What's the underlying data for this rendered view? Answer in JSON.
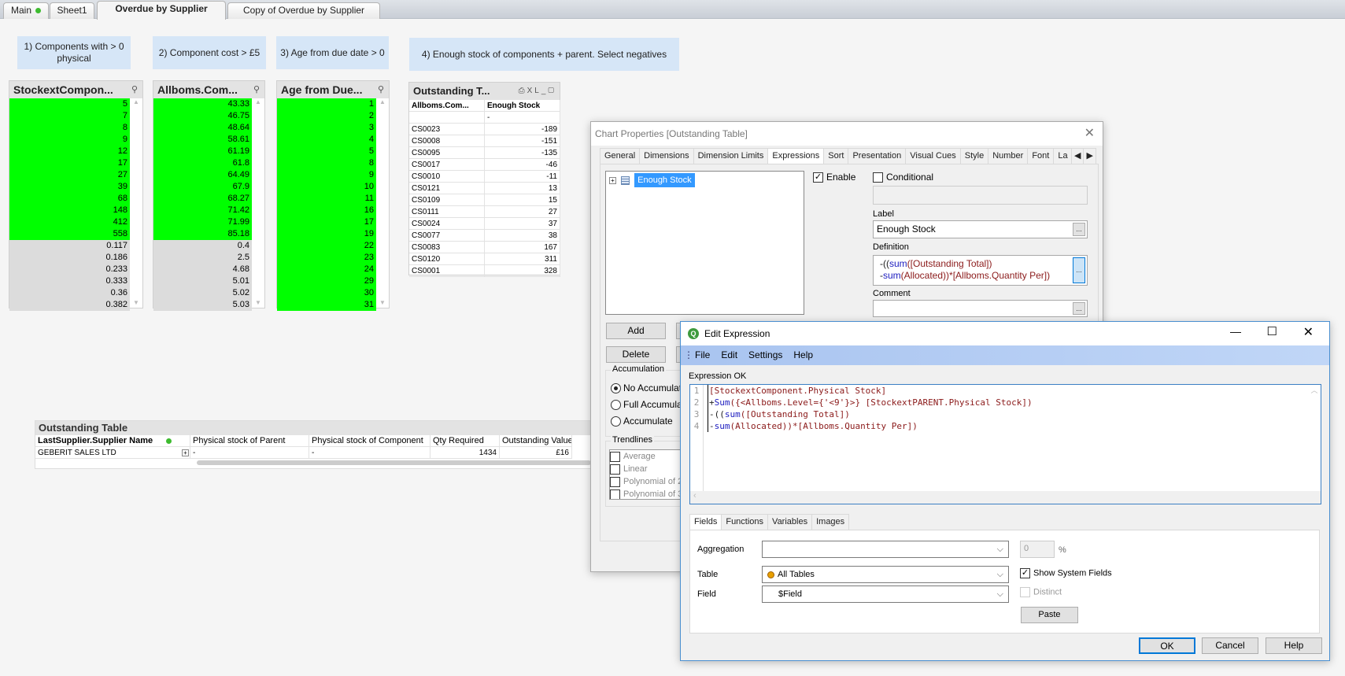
{
  "sheet_tabs": [
    {
      "label": "Main",
      "status": "green"
    },
    {
      "label": "Sheet1"
    },
    {
      "label": "Overdue by Supplier",
      "active": true
    },
    {
      "label": "Copy of Overdue by Supplier"
    }
  ],
  "text_boxes": [
    "1) Components with > 0 physical",
    "2) Component cost > £5",
    "3) Age from due date > 0",
    "4) Enough stock of components + parent. Select negatives"
  ],
  "listboxes": [
    {
      "title": "StockextCompon...",
      "selected": [
        "5",
        "7",
        "8",
        "9",
        "12",
        "17",
        "27",
        "39",
        "68",
        "148",
        "412",
        "558"
      ],
      "excluded": [
        "0.117",
        "0.186",
        "0.233",
        "0.333",
        "0.36",
        "0.382"
      ]
    },
    {
      "title": "Allboms.Com...",
      "selected": [
        "43.33",
        "46.75",
        "48.64",
        "58.61",
        "61.19",
        "61.8",
        "64.49",
        "67.9",
        "68.27",
        "71.42",
        "71.99",
        "85.18"
      ],
      "excluded": [
        "0.4",
        "2.5",
        "4.68",
        "5.01",
        "5.02",
        "5.03"
      ]
    },
    {
      "title": "Age from Due...",
      "selected": [
        "1",
        "2",
        "3",
        "4",
        "5",
        "8",
        "9",
        "10",
        "11",
        "16",
        "17",
        "19",
        "22",
        "23",
        "24",
        "29",
        "30",
        "31"
      ],
      "excluded": []
    }
  ],
  "mini_table": {
    "title": "Outstanding T...",
    "icons": [
      "print-icon",
      "xl-icon",
      "minimize-icon",
      "maximize-icon"
    ],
    "xl_label": "XL",
    "columns": [
      "Allboms.Com...",
      "Enough Stock"
    ],
    "total": [
      "",
      "-"
    ],
    "rows": [
      [
        "CS0023",
        "-189"
      ],
      [
        "CS0008",
        "-151"
      ],
      [
        "CS0095",
        "-135"
      ],
      [
        "CS0017",
        "-46"
      ],
      [
        "CS0010",
        "-11"
      ],
      [
        "CS0121",
        "13"
      ],
      [
        "CS0109",
        "15"
      ],
      [
        "CS0111",
        "27"
      ],
      [
        "CS0024",
        "37"
      ],
      [
        "CS0077",
        "38"
      ],
      [
        "CS0083",
        "167"
      ],
      [
        "CS0120",
        "311"
      ],
      [
        "CS0001",
        "328"
      ]
    ]
  },
  "outstanding_table": {
    "title": "Outstanding Table",
    "columns": [
      "LastSupplier.Supplier Name",
      "Physical stock of Parent",
      "Physical stock of Component",
      "Qty Required",
      "Outstanding Value"
    ],
    "rows": [
      [
        "GEBERIT SALES LTD",
        "-",
        "-",
        "1434",
        "£16"
      ]
    ]
  },
  "chart_properties": {
    "title": "Chart Properties [Outstanding Table]",
    "tabs": [
      "General",
      "Dimensions",
      "Dimension Limits",
      "Expressions",
      "Sort",
      "Presentation",
      "Visual Cues",
      "Style",
      "Number",
      "Font",
      "La"
    ],
    "active_tab": "Expressions",
    "expression_item": "Enough Stock",
    "enable_label": "Enable",
    "enable_checked": true,
    "conditional_label": "Conditional",
    "conditional_checked": false,
    "label_caption": "Label",
    "label_value": "Enough Stock",
    "definition_caption": "Definition",
    "definition_lines": [
      [
        {
          "t": "-((",
          "k": "op"
        },
        {
          "t": "sum",
          "k": "fn"
        },
        {
          "t": "([Outstanding Total])",
          "k": "fld"
        }
      ],
      [
        {
          "t": "-",
          "k": "op"
        },
        {
          "t": "sum",
          "k": "fn"
        },
        {
          "t": "(Allocated))*[Allboms.Quantity Per])",
          "k": "fld"
        }
      ]
    ],
    "comment_caption": "Comment",
    "ellipsis": "...",
    "add_label": "Add",
    "delete_label": "Delete",
    "accumulation": {
      "label": "Accumulation",
      "options": [
        "No Accumulation",
        "Full Accumulation",
        "Accumulate"
      ],
      "selected": 0
    },
    "trendlines": {
      "label": "Trendlines",
      "options": [
        "Average",
        "Linear",
        "Polynomial of 2nd degree",
        "Polynomial of 3rd degree"
      ]
    }
  },
  "edit_expression": {
    "title": "Edit Expression",
    "menu": [
      "File",
      "Edit",
      "Settings",
      "Help"
    ],
    "status": "Expression OK",
    "lines": [
      [
        {
          "t": "[StockextComponent.Physical Stock]",
          "k": "fld"
        }
      ],
      [
        {
          "t": "+",
          "k": "op"
        },
        {
          "t": "Sum",
          "k": "fn"
        },
        {
          "t": "({<Allboms.Level={'<9'}>} [StockextPARENT.Physical Stock])",
          "k": "fld"
        }
      ],
      [
        {
          "t": "-((",
          "k": "op"
        },
        {
          "t": "sum",
          "k": "fn"
        },
        {
          "t": "([Outstanding Total])",
          "k": "fld"
        }
      ],
      [
        {
          "t": "-",
          "k": "op"
        },
        {
          "t": "sum",
          "k": "fn"
        },
        {
          "t": "(Allocated))*[Allboms.Quantity Per])",
          "k": "fld"
        }
      ]
    ],
    "tabs": [
      "Fields",
      "Functions",
      "Variables",
      "Images"
    ],
    "active_tab": "Fields",
    "aggregation_label": "Aggregation",
    "aggregation_value": "",
    "percent_value": "0",
    "percent_sign": "%",
    "table_label": "Table",
    "table_value": "All Tables",
    "field_label": "Field",
    "field_value": "$Field",
    "show_system_fields": "Show System Fields",
    "show_system_fields_checked": true,
    "distinct": "Distinct",
    "distinct_checked": false,
    "paste": "Paste",
    "ok": "OK",
    "cancel": "Cancel",
    "help": "Help",
    "accent_color": "#0078d7"
  }
}
